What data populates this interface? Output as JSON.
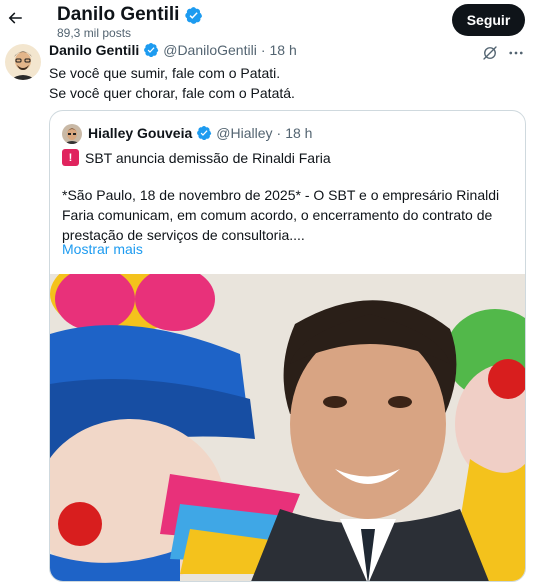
{
  "header": {
    "display_name": "Danilo Gentili",
    "post_count": "89,3 mil posts",
    "follow_label": "Seguir"
  },
  "post": {
    "author_name": "Danilo Gentili",
    "author_handle": "@DaniloGentili",
    "separator": "·",
    "time": "18 h",
    "lines": [
      "Se você que sumir, fale com o Patati.",
      "Se você quer chorar, fale com o Patatá."
    ]
  },
  "quoted": {
    "author_name": "Hialley Gouveia",
    "author_handle": "@Hialley",
    "separator": "·",
    "time": "18 h",
    "title": "SBT anuncia demissão de Rinaldi Faria",
    "body_lines": [
      "*São Paulo, 18 de novembro de 2025* - O SBT e o empresário Rinaldi",
      "Faria comunicam, em comum acordo, o encerramento do contrato de",
      "prestação de serviços de consultoria...."
    ],
    "show_more": "Mostrar mais"
  },
  "colors": {
    "verified": "#1d9bf0",
    "link": "#1d9bf0",
    "muted": "#536471",
    "follow_bg": "#0f1419"
  },
  "icons": [
    "back-arrow-icon",
    "verified-badge-icon",
    "grok-icon",
    "more-icon",
    "siren-emoji-icon"
  ]
}
